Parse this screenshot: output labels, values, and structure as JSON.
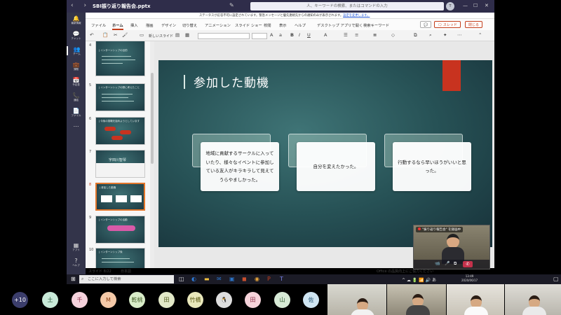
{
  "window": {
    "title": "SBI振り返り報告会.pptx",
    "search_placeholder": "人、キーワードの検索、またはコマンドの入力",
    "user_initials": "T"
  },
  "banner": {
    "text": "ステータスが応答不可に設定されています。緊急メッセージと優先連絡先からの通知のみが表示されます。",
    "link": "設定を変更します。"
  },
  "rail": [
    {
      "icon": "🔔",
      "label": "最新情報"
    },
    {
      "icon": "💬",
      "label": "チャット"
    },
    {
      "icon": "👥",
      "label": "チーム"
    },
    {
      "icon": "💼",
      "label": "課題"
    },
    {
      "icon": "📅",
      "label": "予定表"
    },
    {
      "icon": "📞",
      "label": "通話"
    },
    {
      "icon": "📄",
      "label": "ファイル"
    },
    {
      "icon": "⋯",
      "label": ""
    },
    {
      "icon": "▦",
      "label": "アプリ"
    },
    {
      "icon": "?",
      "label": "ヘルプ"
    }
  ],
  "ribbon": {
    "tabs": [
      "ファイル",
      "ホーム",
      "挿入",
      "描画",
      "デザイン",
      "切り替え",
      "アニメーション",
      "スライド ショー",
      "校閲",
      "表示",
      "ヘルプ",
      "デスクトップ アプリで開く",
      "検索キーワード"
    ],
    "active_tab": "ホーム",
    "comment_btn": "💬",
    "share_btn": "🗨 スレッド",
    "close_btn": "閉じる",
    "new_slide_label": "新しいスライド",
    "font_size": "A"
  },
  "thumbnails": [
    {
      "num": "4",
      "title": "| インターンシップの目的"
    },
    {
      "num": "5",
      "title": "| インターンシップの際に考えたこと"
    },
    {
      "num": "6",
      "title": "| 今後の挑戦を始めようとしています"
    },
    {
      "num": "7",
      "title": "宇田川智琴"
    },
    {
      "num": "8",
      "title": "| 参加した動機"
    },
    {
      "num": "9",
      "title": "| インターンシップの活動"
    },
    {
      "num": "10",
      "title": "| インターンシップ後"
    }
  ],
  "slide": {
    "title": "参加した動機",
    "cards": [
      "地域に貢献するサークルに入っていたり、様々なイベントに参加している友人がキラキラして見えてうらやましかった。",
      "自分を変えたかった。",
      "行動するなら早いほうがいいと思った。"
    ]
  },
  "status": {
    "slide": "スライド 8/22",
    "lang": "日本語",
    "help": "Office の品質向上にご協力ください"
  },
  "video": {
    "caption": "\"振り返り報告会\" を録画中"
  },
  "taskbar": {
    "search": "ここに入力して検索",
    "time": "13:49",
    "date": "2020/06/17"
  },
  "participants": [
    {
      "label": "+10",
      "bg": "#3b3d6b",
      "fg": "#ffffff"
    },
    {
      "label": "土",
      "bg": "#c9ead9",
      "fg": "#2a5a3e"
    },
    {
      "label": "千",
      "bg": "#f5d2dc",
      "fg": "#8a2c46"
    },
    {
      "label": "M",
      "bg": "#f4c9a8",
      "fg": "#8a3e12"
    },
    {
      "label": "乾桃",
      "bg": "#d8ecc8",
      "fg": "#3e5a23"
    },
    {
      "label": "田",
      "bg": "#e3e9c8",
      "fg": "#525c1e"
    },
    {
      "label": "竹橋",
      "bg": "#e9e8bb",
      "fg": "#5b5a14"
    },
    {
      "label": "🐧",
      "bg": "#dddddd",
      "fg": "#333333"
    },
    {
      "label": "田",
      "bg": "#f6d3da",
      "fg": "#8a2c46"
    },
    {
      "label": "山",
      "bg": "#d7ead6",
      "fg": "#2f5a2e"
    },
    {
      "label": "佐",
      "bg": "#cfe5f2",
      "fg": "#1e4f6e"
    }
  ]
}
